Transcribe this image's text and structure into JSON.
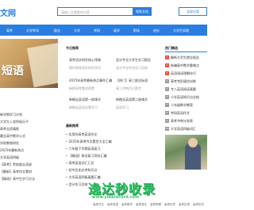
{
  "header": {
    "logo_text": "文网",
    "search_placeholder": "请输入您需要的内容",
    "search_button": "搜索文档",
    "hot_button": "全部分类"
  },
  "nav": {
    "items": [
      "高考",
      "大学考试",
      "励志",
      "大学",
      "考研",
      "留学",
      "职场",
      "创业",
      "大学生实践"
    ]
  },
  "banner": {
    "text": "短语"
  },
  "left_list": [
    "新学期学习计划",
    "大学生入党积极分子",
    "高考志愿填报",
    "最全高中数学公式",
    "学前教育研究",
    "2025年最新热点",
    "大学英语四级",
    "【高考】考前励志语录",
    "【最新】高考作文素材",
    "【精选】高中生学习方法"
  ],
  "middle": {
    "title": "今日推荐",
    "featured": [
      {
        "title": "高考语文研究核心领域",
        "meta": "国内高考语文研究状况"
      },
      {
        "title": "会计专业大学生实习报告",
        "meta": "会计专业毕业实习总结"
      },
      {
        "title": "2025年高考最新热点事件汇编",
        "meta": "新鲜高考素材积累"
      },
      {
        "title": "【热门】高三励志标语",
        "meta": "高三冲刺百日誓言"
      },
      {
        "title": "新概念英语第一册课文",
        "meta": "新概念英语全套学习"
      },
      {
        "title": "新概念英语第二册课文",
        "meta": "英语学习"
      }
    ],
    "list_title": "最新推荐",
    "list": [
      "实用的高考英语作文",
      "2025年高考作文题目大全汇编",
      "六年级下学期英语复习",
      "【精选】政治复习资料汇编",
      "高考英语词汇汇总",
      "初中历史必考知识点",
      "大学英语四级真题汇编",
      "会计实习总结"
    ]
  },
  "right": {
    "title": "热门精选",
    "items": [
      {
        "num": "1",
        "text": "最新大学生就业报告"
      },
      {
        "num": "2",
        "text": "新编高中数学重难点"
      },
      {
        "num": "3",
        "text": "英语阅读理解技巧"
      },
      {
        "num": "4",
        "text": "高考完形填空训练"
      },
      {
        "num": "5",
        "text": "专八英语阅读真题"
      },
      {
        "num": "6",
        "text": "小学英语知识点总结"
      },
      {
        "num": "7",
        "text": "二年级数学教案"
      },
      {
        "num": "8",
        "text": "考研英语作文"
      },
      {
        "num": "9",
        "text": "高考冲刺计划表"
      },
      {
        "num": "10",
        "text": "大学英语四级词汇"
      }
    ]
  },
  "footer": {
    "items": [
      "高考作文",
      "高考英语",
      "高考数学",
      "高考语文",
      "高考物理",
      "高考化学",
      "高考生物",
      "高考历史"
    ]
  },
  "watermark": {
    "text": "逸达秒收录",
    "url": "www.yidarecord.com"
  },
  "colors": {
    "accent": "#2a7de1",
    "hot": "#e94e3c",
    "watermark": "#33c46a"
  }
}
